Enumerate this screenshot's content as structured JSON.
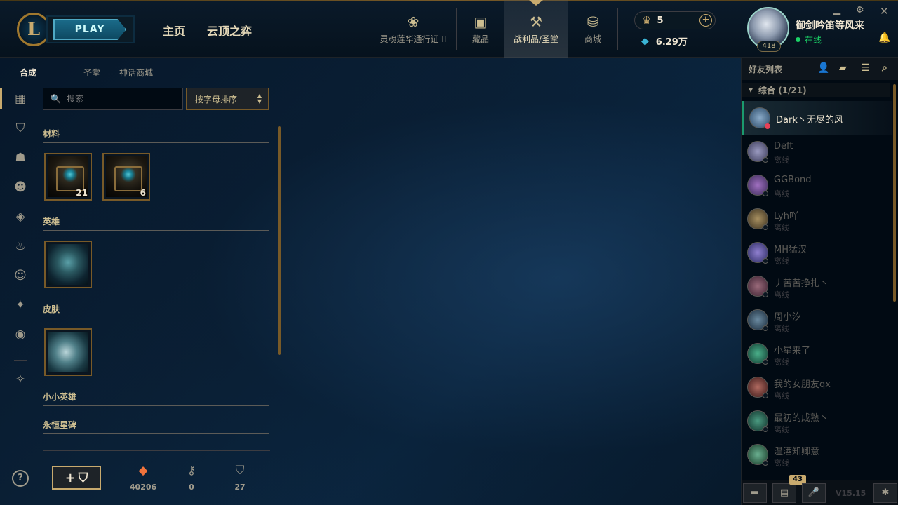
{
  "header": {
    "logo": "L",
    "play_label": "PLAY",
    "nav_home": "主页",
    "nav_tft": "云顶之弈",
    "nav_items": [
      {
        "label": "灵魂莲华通行证 II",
        "icon": "lotus-icon"
      },
      {
        "label": "藏品",
        "icon": "collection-bag-icon"
      },
      {
        "label": "战利品/圣堂",
        "icon": "loot-hammer-icon"
      },
      {
        "label": "商城",
        "icon": "store-coins-icon"
      }
    ],
    "rp_value": "5",
    "be_value": "6.29万",
    "summoner_level": "418",
    "summoner_name": "御剑吟笛等风来",
    "status_text": "在线"
  },
  "loot": {
    "subtabs": [
      "合成",
      "圣堂",
      "神话商城"
    ],
    "search_placeholder": "搜索",
    "sort_label": "按字母排序",
    "sections": [
      "材料",
      "英雄",
      "皮肤",
      "小小英雄",
      "永恒星碑"
    ],
    "materials": [
      {
        "name": "hextech-chest",
        "count": "21"
      },
      {
        "name": "masterwork-chest",
        "count": "6"
      }
    ],
    "resources": [
      {
        "icon": "orange-essence-icon",
        "value": "40206",
        "color": "#f0733c"
      },
      {
        "icon": "key-fragment-icon",
        "value": "0",
        "color": "#a09b8c"
      },
      {
        "icon": "chest-icon",
        "value": "27",
        "color": "#a09b8c"
      }
    ],
    "help": "?"
  },
  "friends": {
    "title": "好友列表",
    "group_label": "综合 (1/21)",
    "list": [
      {
        "name": "Dark丶无尽的风",
        "status": "",
        "online": true,
        "color": "#4a6a88"
      },
      {
        "name": "Deft",
        "status": "离线",
        "online": false,
        "color": "#6a6a88"
      },
      {
        "name": "GGBond",
        "status": "离线",
        "online": false,
        "color": "#6a4a88"
      },
      {
        "name": "Lyh吖",
        "status": "离线",
        "online": false,
        "color": "#6a5a3a"
      },
      {
        "name": "MH猛汉",
        "status": "离线",
        "online": false,
        "color": "#5a4a8a"
      },
      {
        "name": "丿苦苦挣扎丶",
        "status": "离线",
        "online": false,
        "color": "#5a3a4a"
      },
      {
        "name": "周小汐",
        "status": "离线",
        "online": false,
        "color": "#3a4a5a"
      },
      {
        "name": "小星来了",
        "status": "离线",
        "online": false,
        "color": "#2a6a5a"
      },
      {
        "name": "我的女朋友qx",
        "status": "离线",
        "online": false,
        "color": "#6a3a3a"
      },
      {
        "name": "最初的成熟丶",
        "status": "离线",
        "online": false,
        "color": "#2a5a4a"
      },
      {
        "name": "温酒知卿意",
        "status": "离线",
        "online": false,
        "color": "#3a6a4a"
      }
    ],
    "chat_badge": "43",
    "version": "V15.15"
  }
}
